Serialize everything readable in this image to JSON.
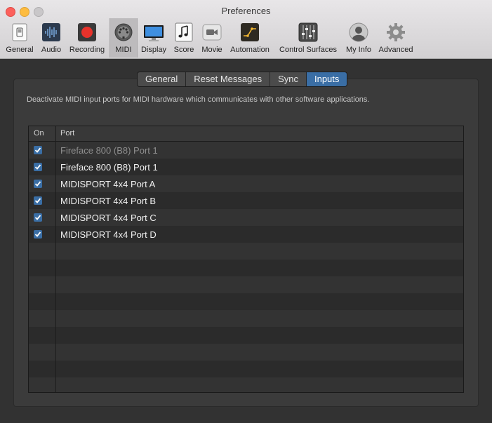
{
  "window": {
    "title": "Preferences"
  },
  "toolbar": {
    "items": [
      {
        "label": "General",
        "icon": "switch-icon"
      },
      {
        "label": "Audio",
        "icon": "waveform-icon"
      },
      {
        "label": "Recording",
        "icon": "record-icon"
      },
      {
        "label": "MIDI",
        "icon": "midi-connector-icon",
        "selected": true
      },
      {
        "label": "Display",
        "icon": "monitor-icon"
      },
      {
        "label": "Score",
        "icon": "music-note-icon"
      },
      {
        "label": "Movie",
        "icon": "video-camera-icon"
      },
      {
        "label": "Automation",
        "icon": "automation-curve-icon"
      },
      {
        "label": "Control Surfaces",
        "icon": "faders-icon"
      },
      {
        "label": "My Info",
        "icon": "user-icon"
      },
      {
        "label": "Advanced",
        "icon": "gear-icon"
      }
    ]
  },
  "tabs": [
    {
      "label": "General"
    },
    {
      "label": "Reset Messages"
    },
    {
      "label": "Sync"
    },
    {
      "label": "Inputs",
      "active": true
    }
  ],
  "description": "Deactivate MIDI input ports for MIDI hardware which communicates with other software applications.",
  "table": {
    "columns": {
      "on": "On",
      "port": "Port"
    },
    "rows": [
      {
        "checked": true,
        "port": "Fireface 800 (B8) Port 1",
        "dimmed": true
      },
      {
        "checked": true,
        "port": "Fireface 800 (B8) Port 1",
        "dimmed": false
      },
      {
        "checked": true,
        "port": "MIDISPORT 4x4 Port A",
        "dimmed": false
      },
      {
        "checked": true,
        "port": "MIDISPORT 4x4 Port B",
        "dimmed": false
      },
      {
        "checked": true,
        "port": "MIDISPORT 4x4 Port C",
        "dimmed": false
      },
      {
        "checked": true,
        "port": "MIDISPORT 4x4 Port D",
        "dimmed": false
      }
    ]
  },
  "colors": {
    "accent": "#3a6ea5",
    "close": "#fc605c",
    "minimize": "#fdbc40",
    "record_red": "#e8322b",
    "automation_yellow": "#f2b631"
  }
}
